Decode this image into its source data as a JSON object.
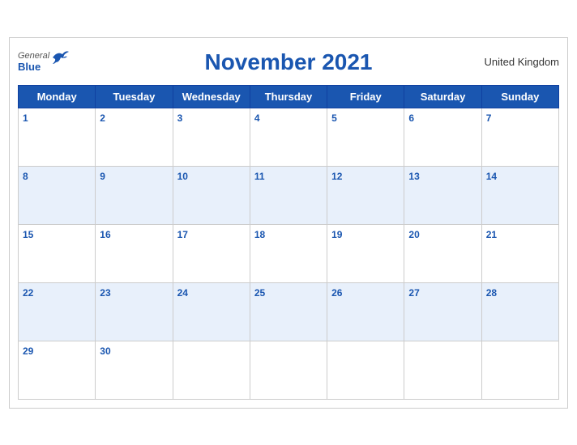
{
  "header": {
    "logo_general": "General",
    "logo_blue": "Blue",
    "title": "November 2021",
    "country": "United Kingdom"
  },
  "weekdays": [
    "Monday",
    "Tuesday",
    "Wednesday",
    "Thursday",
    "Friday",
    "Saturday",
    "Sunday"
  ],
  "weeks": [
    [
      1,
      2,
      3,
      4,
      5,
      6,
      7
    ],
    [
      8,
      9,
      10,
      11,
      12,
      13,
      14
    ],
    [
      15,
      16,
      17,
      18,
      19,
      20,
      21
    ],
    [
      22,
      23,
      24,
      25,
      26,
      27,
      28
    ],
    [
      29,
      30,
      null,
      null,
      null,
      null,
      null
    ]
  ]
}
